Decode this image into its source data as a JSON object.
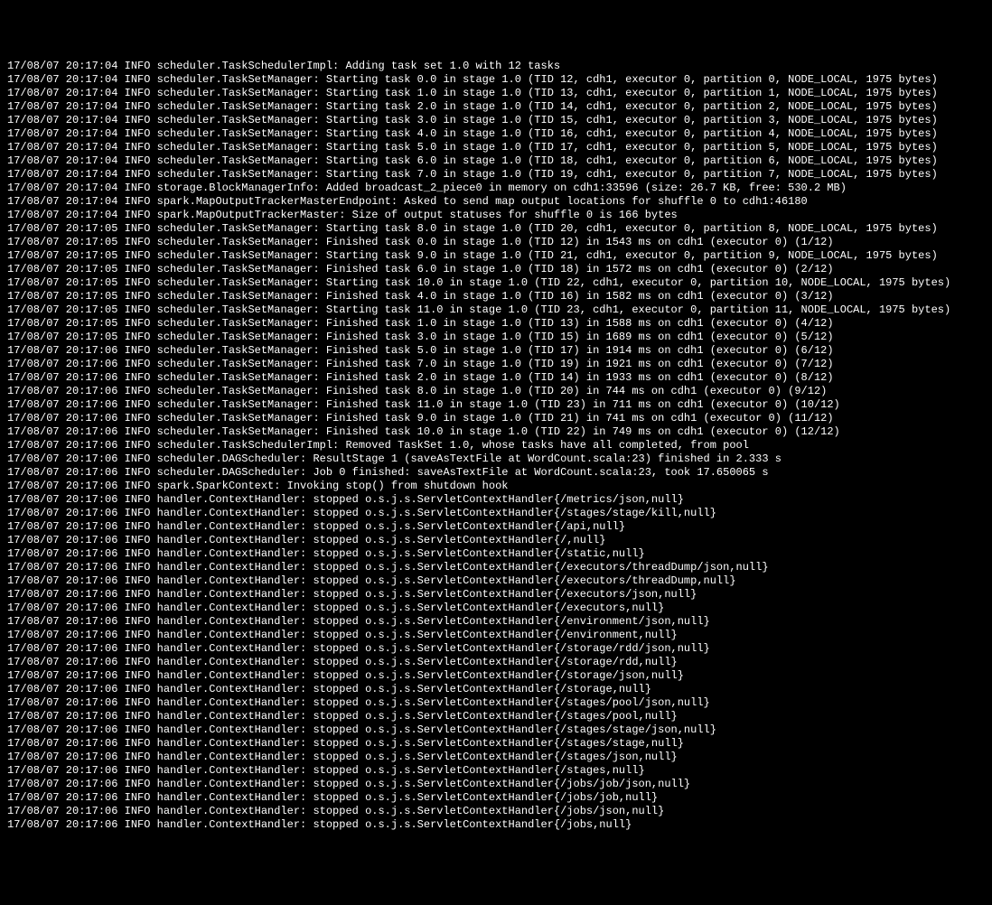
{
  "log_lines": [
    "17/08/07 20:17:04 INFO scheduler.TaskSchedulerImpl: Adding task set 1.0 with 12 tasks",
    "17/08/07 20:17:04 INFO scheduler.TaskSetManager: Starting task 0.0 in stage 1.0 (TID 12, cdh1, executor 0, partition 0, NODE_LOCAL, 1975 bytes)",
    "17/08/07 20:17:04 INFO scheduler.TaskSetManager: Starting task 1.0 in stage 1.0 (TID 13, cdh1, executor 0, partition 1, NODE_LOCAL, 1975 bytes)",
    "17/08/07 20:17:04 INFO scheduler.TaskSetManager: Starting task 2.0 in stage 1.0 (TID 14, cdh1, executor 0, partition 2, NODE_LOCAL, 1975 bytes)",
    "17/08/07 20:17:04 INFO scheduler.TaskSetManager: Starting task 3.0 in stage 1.0 (TID 15, cdh1, executor 0, partition 3, NODE_LOCAL, 1975 bytes)",
    "17/08/07 20:17:04 INFO scheduler.TaskSetManager: Starting task 4.0 in stage 1.0 (TID 16, cdh1, executor 0, partition 4, NODE_LOCAL, 1975 bytes)",
    "17/08/07 20:17:04 INFO scheduler.TaskSetManager: Starting task 5.0 in stage 1.0 (TID 17, cdh1, executor 0, partition 5, NODE_LOCAL, 1975 bytes)",
    "17/08/07 20:17:04 INFO scheduler.TaskSetManager: Starting task 6.0 in stage 1.0 (TID 18, cdh1, executor 0, partition 6, NODE_LOCAL, 1975 bytes)",
    "17/08/07 20:17:04 INFO scheduler.TaskSetManager: Starting task 7.0 in stage 1.0 (TID 19, cdh1, executor 0, partition 7, NODE_LOCAL, 1975 bytes)",
    "17/08/07 20:17:04 INFO storage.BlockManagerInfo: Added broadcast_2_piece0 in memory on cdh1:33596 (size: 26.7 KB, free: 530.2 MB)",
    "17/08/07 20:17:04 INFO spark.MapOutputTrackerMasterEndpoint: Asked to send map output locations for shuffle 0 to cdh1:46180",
    "17/08/07 20:17:04 INFO spark.MapOutputTrackerMaster: Size of output statuses for shuffle 0 is 166 bytes",
    "17/08/07 20:17:05 INFO scheduler.TaskSetManager: Starting task 8.0 in stage 1.0 (TID 20, cdh1, executor 0, partition 8, NODE_LOCAL, 1975 bytes)",
    "17/08/07 20:17:05 INFO scheduler.TaskSetManager: Finished task 0.0 in stage 1.0 (TID 12) in 1543 ms on cdh1 (executor 0) (1/12)",
    "17/08/07 20:17:05 INFO scheduler.TaskSetManager: Starting task 9.0 in stage 1.0 (TID 21, cdh1, executor 0, partition 9, NODE_LOCAL, 1975 bytes)",
    "17/08/07 20:17:05 INFO scheduler.TaskSetManager: Finished task 6.0 in stage 1.0 (TID 18) in 1572 ms on cdh1 (executor 0) (2/12)",
    "17/08/07 20:17:05 INFO scheduler.TaskSetManager: Starting task 10.0 in stage 1.0 (TID 22, cdh1, executor 0, partition 10, NODE_LOCAL, 1975 bytes)",
    "17/08/07 20:17:05 INFO scheduler.TaskSetManager: Finished task 4.0 in stage 1.0 (TID 16) in 1582 ms on cdh1 (executor 0) (3/12)",
    "17/08/07 20:17:05 INFO scheduler.TaskSetManager: Starting task 11.0 in stage 1.0 (TID 23, cdh1, executor 0, partition 11, NODE_LOCAL, 1975 bytes)",
    "17/08/07 20:17:05 INFO scheduler.TaskSetManager: Finished task 1.0 in stage 1.0 (TID 13) in 1588 ms on cdh1 (executor 0) (4/12)",
    "17/08/07 20:17:05 INFO scheduler.TaskSetManager: Finished task 3.0 in stage 1.0 (TID 15) in 1689 ms on cdh1 (executor 0) (5/12)",
    "17/08/07 20:17:06 INFO scheduler.TaskSetManager: Finished task 5.0 in stage 1.0 (TID 17) in 1914 ms on cdh1 (executor 0) (6/12)",
    "17/08/07 20:17:06 INFO scheduler.TaskSetManager: Finished task 7.0 in stage 1.0 (TID 19) in 1921 ms on cdh1 (executor 0) (7/12)",
    "17/08/07 20:17:06 INFO scheduler.TaskSetManager: Finished task 2.0 in stage 1.0 (TID 14) in 1933 ms on cdh1 (executor 0) (8/12)",
    "17/08/07 20:17:06 INFO scheduler.TaskSetManager: Finished task 8.0 in stage 1.0 (TID 20) in 744 ms on cdh1 (executor 0) (9/12)",
    "17/08/07 20:17:06 INFO scheduler.TaskSetManager: Finished task 11.0 in stage 1.0 (TID 23) in 711 ms on cdh1 (executor 0) (10/12)",
    "17/08/07 20:17:06 INFO scheduler.TaskSetManager: Finished task 9.0 in stage 1.0 (TID 21) in 741 ms on cdh1 (executor 0) (11/12)",
    "17/08/07 20:17:06 INFO scheduler.TaskSetManager: Finished task 10.0 in stage 1.0 (TID 22) in 749 ms on cdh1 (executor 0) (12/12)",
    "17/08/07 20:17:06 INFO scheduler.TaskSchedulerImpl: Removed TaskSet 1.0, whose tasks have all completed, from pool",
    "17/08/07 20:17:06 INFO scheduler.DAGScheduler: ResultStage 1 (saveAsTextFile at WordCount.scala:23) finished in 2.333 s",
    "17/08/07 20:17:06 INFO scheduler.DAGScheduler: Job 0 finished: saveAsTextFile at WordCount.scala:23, took 17.650065 s",
    "17/08/07 20:17:06 INFO spark.SparkContext: Invoking stop() from shutdown hook",
    "17/08/07 20:17:06 INFO handler.ContextHandler: stopped o.s.j.s.ServletContextHandler{/metrics/json,null}",
    "17/08/07 20:17:06 INFO handler.ContextHandler: stopped o.s.j.s.ServletContextHandler{/stages/stage/kill,null}",
    "17/08/07 20:17:06 INFO handler.ContextHandler: stopped o.s.j.s.ServletContextHandler{/api,null}",
    "17/08/07 20:17:06 INFO handler.ContextHandler: stopped o.s.j.s.ServletContextHandler{/,null}",
    "17/08/07 20:17:06 INFO handler.ContextHandler: stopped o.s.j.s.ServletContextHandler{/static,null}",
    "17/08/07 20:17:06 INFO handler.ContextHandler: stopped o.s.j.s.ServletContextHandler{/executors/threadDump/json,null}",
    "17/08/07 20:17:06 INFO handler.ContextHandler: stopped o.s.j.s.ServletContextHandler{/executors/threadDump,null}",
    "17/08/07 20:17:06 INFO handler.ContextHandler: stopped o.s.j.s.ServletContextHandler{/executors/json,null}",
    "17/08/07 20:17:06 INFO handler.ContextHandler: stopped o.s.j.s.ServletContextHandler{/executors,null}",
    "17/08/07 20:17:06 INFO handler.ContextHandler: stopped o.s.j.s.ServletContextHandler{/environment/json,null}",
    "17/08/07 20:17:06 INFO handler.ContextHandler: stopped o.s.j.s.ServletContextHandler{/environment,null}",
    "17/08/07 20:17:06 INFO handler.ContextHandler: stopped o.s.j.s.ServletContextHandler{/storage/rdd/json,null}",
    "17/08/07 20:17:06 INFO handler.ContextHandler: stopped o.s.j.s.ServletContextHandler{/storage/rdd,null}",
    "17/08/07 20:17:06 INFO handler.ContextHandler: stopped o.s.j.s.ServletContextHandler{/storage/json,null}",
    "17/08/07 20:17:06 INFO handler.ContextHandler: stopped o.s.j.s.ServletContextHandler{/storage,null}",
    "17/08/07 20:17:06 INFO handler.ContextHandler: stopped o.s.j.s.ServletContextHandler{/stages/pool/json,null}",
    "17/08/07 20:17:06 INFO handler.ContextHandler: stopped o.s.j.s.ServletContextHandler{/stages/pool,null}",
    "17/08/07 20:17:06 INFO handler.ContextHandler: stopped o.s.j.s.ServletContextHandler{/stages/stage/json,null}",
    "17/08/07 20:17:06 INFO handler.ContextHandler: stopped o.s.j.s.ServletContextHandler{/stages/stage,null}",
    "17/08/07 20:17:06 INFO handler.ContextHandler: stopped o.s.j.s.ServletContextHandler{/stages/json,null}",
    "17/08/07 20:17:06 INFO handler.ContextHandler: stopped o.s.j.s.ServletContextHandler{/stages,null}",
    "17/08/07 20:17:06 INFO handler.ContextHandler: stopped o.s.j.s.ServletContextHandler{/jobs/job/json,null}",
    "17/08/07 20:17:06 INFO handler.ContextHandler: stopped o.s.j.s.ServletContextHandler{/jobs/job,null}",
    "17/08/07 20:17:06 INFO handler.ContextHandler: stopped o.s.j.s.ServletContextHandler{/jobs/json,null}",
    "17/08/07 20:17:06 INFO handler.ContextHandler: stopped o.s.j.s.ServletContextHandler{/jobs,null}"
  ]
}
